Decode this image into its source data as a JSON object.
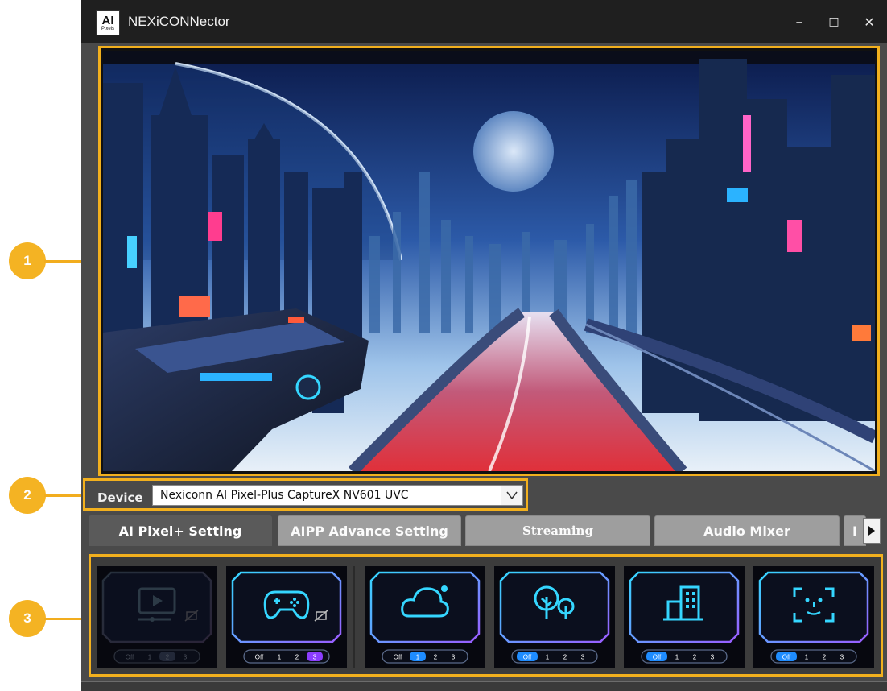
{
  "window": {
    "title": "NEXiCONNector",
    "logo_text": "AI",
    "logo_subtext": "Pixels",
    "minimize_glyph": "–",
    "maximize_glyph": "□",
    "close_glyph": "✕"
  },
  "callouts": [
    "1",
    "2",
    "3"
  ],
  "device": {
    "label": "Device",
    "selected": "Nexiconn AI Pixel-Plus CaptureX NV601 UVC"
  },
  "tabs": [
    {
      "label": "AI Pixel+ Setting",
      "active": true
    },
    {
      "label": "AIPP Advance Setting",
      "active": false
    },
    {
      "label": "Streaming",
      "active": false
    },
    {
      "label": "Audio Mixer",
      "active": false
    },
    {
      "label": "I",
      "active": false
    }
  ],
  "modes": [
    {
      "icon": "video-player-icon",
      "levels": [
        "Off",
        "1",
        "2",
        "3"
      ],
      "selected": "2",
      "enabled": false
    },
    {
      "icon": "gamepad-icon",
      "levels": [
        "Off",
        "1",
        "2",
        "3"
      ],
      "selected": "3",
      "enabled": true
    },
    {
      "icon": "cloud-icon",
      "levels": [
        "Off",
        "1",
        "2",
        "3"
      ],
      "selected": "1",
      "enabled": true
    },
    {
      "icon": "trees-icon",
      "levels": [
        "Off",
        "1",
        "2",
        "3"
      ],
      "selected": "Off",
      "enabled": true
    },
    {
      "icon": "building-icon",
      "levels": [
        "Off",
        "1",
        "2",
        "3"
      ],
      "selected": "Off",
      "enabled": true
    },
    {
      "icon": "face-scan-icon",
      "levels": [
        "Off",
        "1",
        "2",
        "3"
      ],
      "selected": "Off",
      "enabled": true
    }
  ],
  "colors": {
    "accent": "#f2b01e",
    "neon_cyan": "#35d6ff",
    "neon_purple": "#9a5cff",
    "selected_blue": "#1e8cff",
    "selected_purple": "#8b3dff"
  }
}
